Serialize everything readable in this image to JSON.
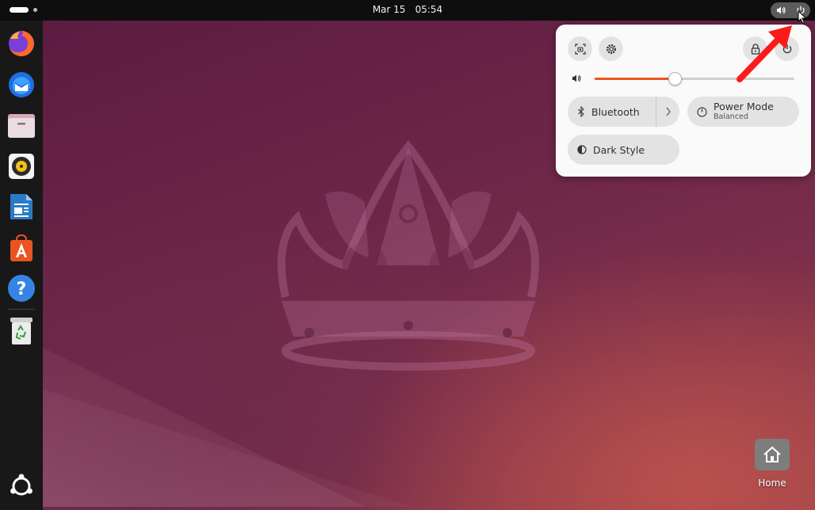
{
  "topbar": {
    "date": "Mar 15",
    "time": "05:54",
    "tray_icons": [
      "speaker-icon",
      "power-icon"
    ]
  },
  "dock": {
    "items": [
      {
        "name": "firefox",
        "icon": "firefox-icon"
      },
      {
        "name": "thunderbird",
        "icon": "thunderbird-icon"
      },
      {
        "name": "files",
        "icon": "files-icon"
      },
      {
        "name": "rhythmbox",
        "icon": "rhythmbox-icon"
      },
      {
        "name": "libreoffice-writer",
        "icon": "writer-icon"
      },
      {
        "name": "app-center",
        "icon": "app-center-icon"
      },
      {
        "name": "help",
        "icon": "help-icon",
        "glyph": "?"
      },
      {
        "name": "trash",
        "icon": "trash-icon"
      }
    ],
    "show_apps_icon": "ubuntu-logo-icon"
  },
  "quick_settings": {
    "top_buttons": [
      "screenshot-icon",
      "settings-icon",
      "lock-icon",
      "power-icon"
    ],
    "volume": {
      "icon": "speaker-icon",
      "level": 0.4
    },
    "toggles": {
      "bluetooth": {
        "label": "Bluetooth",
        "icon": "bluetooth-icon"
      },
      "power_mode": {
        "label": "Power Mode",
        "sublabel": "Balanced",
        "icon": "power-mode-icon"
      },
      "dark_style": {
        "label": "Dark Style",
        "icon": "dark-style-icon"
      }
    }
  },
  "desktop": {
    "home_label": "Home"
  },
  "colors": {
    "accent": "#e95420",
    "topbar": "#0e0e0e",
    "dock": "#181818",
    "panel": "#fafafa",
    "annotation": "#ff1a1a"
  }
}
